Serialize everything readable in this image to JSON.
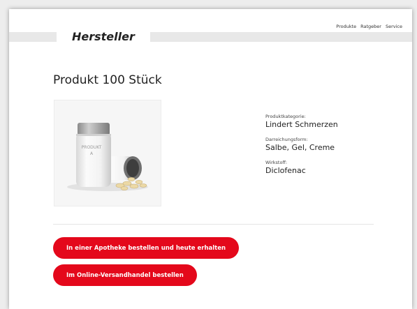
{
  "header": {
    "logo": "Hersteller",
    "nav": [
      "Produkte",
      "Ratgeber",
      "Service"
    ]
  },
  "product": {
    "title": "Produkt 100 Stück",
    "image_label": "PRODUKT A",
    "image_label_line1": "PRODUKT",
    "image_label_line2": "A",
    "details": [
      {
        "label": "Produktkategorie:",
        "value": "Lindert Schmerzen"
      },
      {
        "label": "Darreichungsform:",
        "value": "Salbe, Gel, Creme"
      },
      {
        "label": "Wirkstoff:",
        "value": "Diclofenac"
      }
    ]
  },
  "actions": {
    "pharmacy_label": "In einer Apotheke bestellen und heute erhalten",
    "online_label": "Im Online-Versandhandel bestellen"
  },
  "colors": {
    "accent": "#e4081b",
    "background": "#ededed",
    "page": "#ffffff"
  }
}
